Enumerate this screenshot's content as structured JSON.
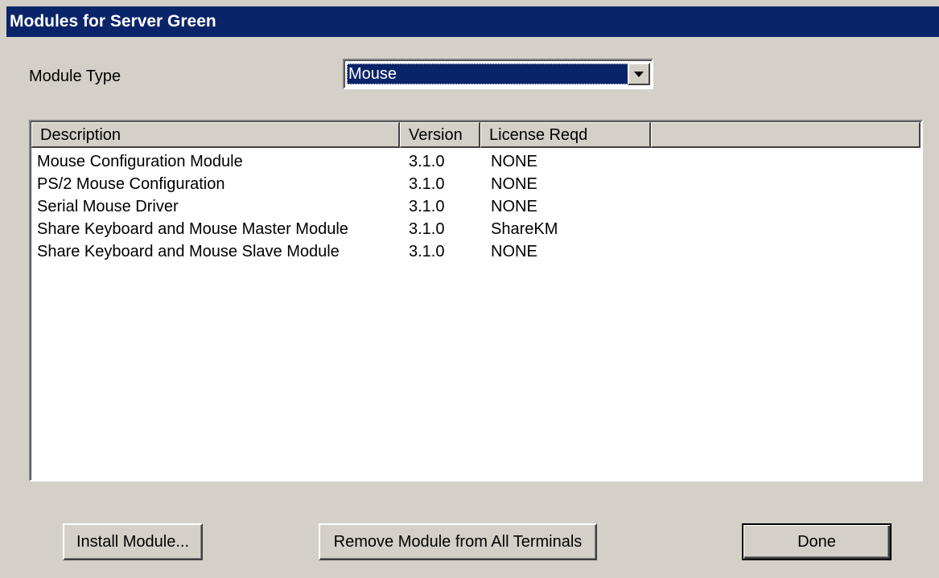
{
  "window": {
    "title": "Modules for Server Green"
  },
  "module_type": {
    "label": "Module Type",
    "selected": "Mouse"
  },
  "list": {
    "columns": [
      "Description",
      "Version",
      "License Reqd"
    ],
    "rows": [
      {
        "description": "Mouse Configuration Module",
        "version": "3.1.0",
        "license": "NONE"
      },
      {
        "description": "PS/2 Mouse Configuration",
        "version": "3.1.0",
        "license": "NONE"
      },
      {
        "description": "Serial Mouse Driver",
        "version": "3.1.0",
        "license": "NONE"
      },
      {
        "description": "Share Keyboard and Mouse Master Module",
        "version": "3.1.0",
        "license": "ShareKM"
      },
      {
        "description": "Share Keyboard and Mouse Slave Module",
        "version": "3.1.0",
        "license": "NONE"
      }
    ]
  },
  "buttons": {
    "install": "Install Module...",
    "remove": "Remove Module from All Terminals",
    "done": "Done"
  },
  "icons": {
    "dropdown": "chevron-down-icon"
  },
  "colors": {
    "title_bar": "#0a246a",
    "selection": "#0a246a",
    "face": "#d4d0c8"
  }
}
